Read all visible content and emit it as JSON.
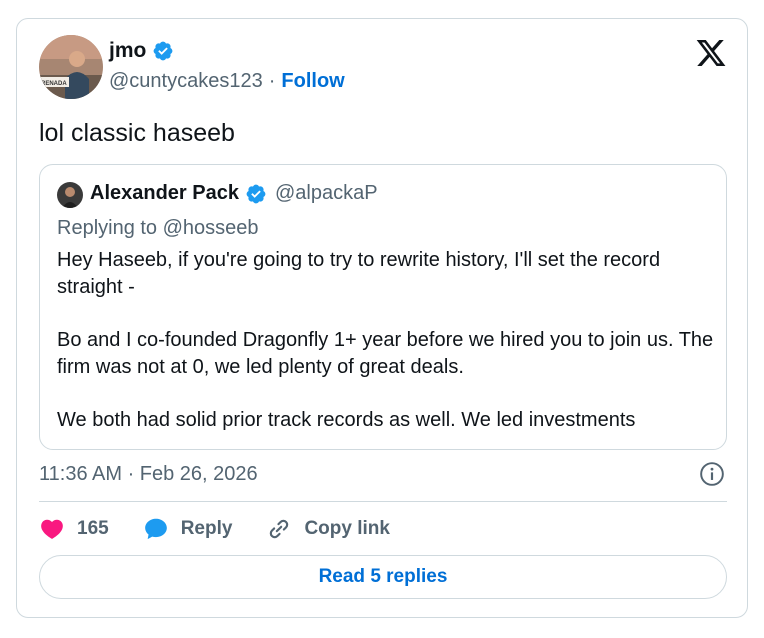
{
  "tweet": {
    "author_name": "jmo",
    "handle": "@cuntycakes123",
    "separator": "·",
    "follow_label": "Follow",
    "text": "lol classic haseeb",
    "timestamp": "11:36 AM · Feb 26, 2026",
    "avatar_sign_text": "RENADA"
  },
  "quoted": {
    "author_name": "Alexander Pack",
    "handle": "@alpackaP",
    "replying_to": "Replying to @hosseeb",
    "paragraphs": [
      "Hey Haseeb, if you're going to try to rewrite history, I'll set the record straight -",
      "Bo and I co-founded Dragonfly 1+ year before we hired you to join us. The firm was not at 0, we led plenty of great deals.",
      "We both had solid prior track records as well. We led investments"
    ]
  },
  "actions": {
    "like_count": "165",
    "reply_label": "Reply",
    "copy_link_label": "Copy link",
    "read_replies_label": "Read 5 replies"
  },
  "icons": {
    "logo": "x-logo-icon",
    "verified": "verified-badge-icon",
    "info": "info-icon",
    "like": "heart-icon",
    "reply": "speech-bubble-icon",
    "copy": "link-icon"
  },
  "colors": {
    "accent_blue": "#006fd6",
    "verified_blue": "#1d9bf0",
    "like_pink": "#f91880",
    "secondary_text": "#536471",
    "border": "#cfd9de"
  }
}
